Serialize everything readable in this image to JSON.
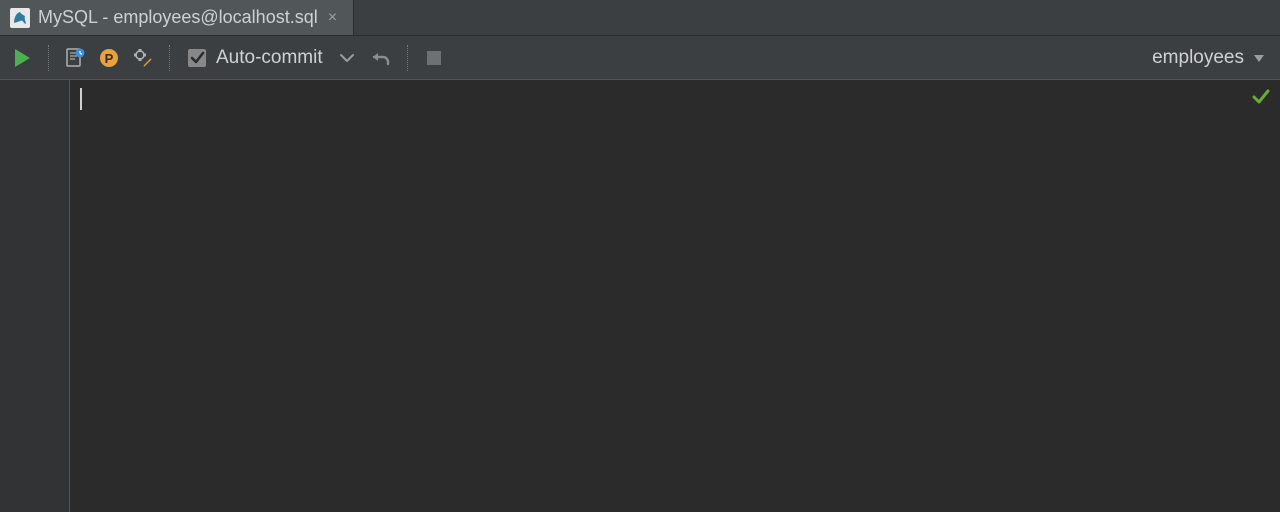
{
  "tab": {
    "title": "MySQL - employees@localhost.sql",
    "icon": "db-dolphin"
  },
  "toolbar": {
    "auto_commit_label": "Auto-commit",
    "auto_commit_checked": true
  },
  "schema": {
    "selected": "employees"
  },
  "editor": {
    "content": ""
  }
}
